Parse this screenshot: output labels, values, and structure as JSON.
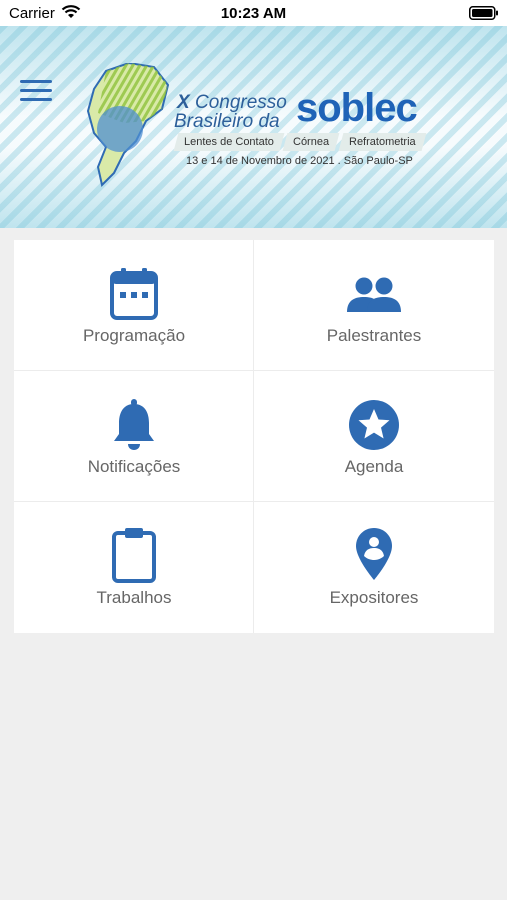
{
  "status_bar": {
    "carrier": "Carrier",
    "time": "10:23 AM"
  },
  "banner": {
    "title_roman": "X",
    "title_line1": "Congresso",
    "title_line2": "Brasileiro da",
    "brand": "soblec",
    "tags": [
      "Lentes de Contato",
      "Córnea",
      "Refratometria"
    ],
    "date": "13 e 14 de Novembro de 2021 . São Paulo-SP"
  },
  "menu": [
    {
      "label": "Programação",
      "icon": "calendar-icon"
    },
    {
      "label": "Palestrantes",
      "icon": "people-icon"
    },
    {
      "label": "Notificações",
      "icon": "bell-icon"
    },
    {
      "label": "Agenda",
      "icon": "star-icon"
    },
    {
      "label": "Trabalhos",
      "icon": "clipboard-icon"
    },
    {
      "label": "Expositores",
      "icon": "map-pin-icon"
    }
  ],
  "colors": {
    "accent": "#2f6bb3",
    "label": "#666666",
    "background": "#efefef"
  }
}
